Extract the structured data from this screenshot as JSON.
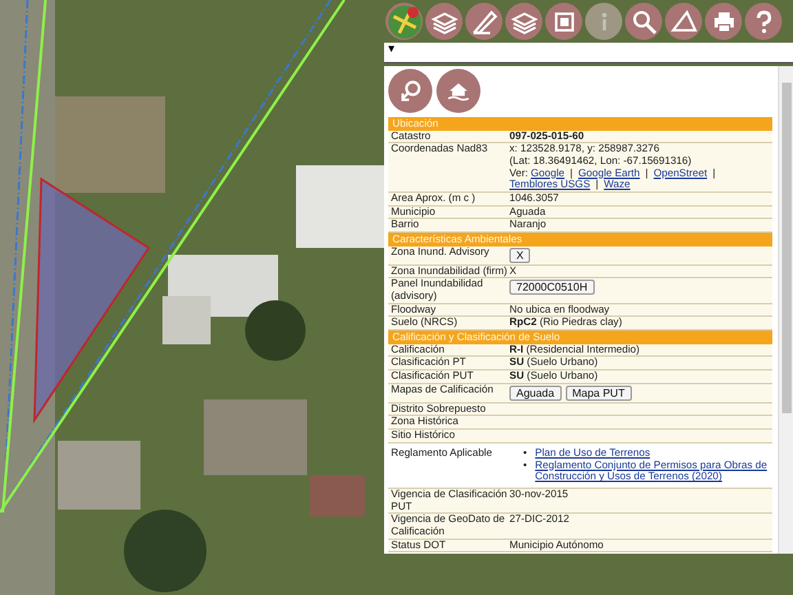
{
  "toolbar": [
    {
      "kind": "map",
      "disabled": false
    },
    {
      "kind": "layers",
      "disabled": false
    },
    {
      "kind": "pencil",
      "disabled": false
    },
    {
      "kind": "layers",
      "disabled": false
    },
    {
      "kind": "frame",
      "disabled": false
    },
    {
      "kind": "info",
      "disabled": true
    },
    {
      "kind": "search",
      "disabled": false
    },
    {
      "kind": "measure",
      "disabled": false
    },
    {
      "kind": "print",
      "disabled": false
    },
    {
      "kind": "help",
      "disabled": false
    }
  ],
  "panel_toggle": "▾",
  "panel_tools": [
    {
      "kind": "link"
    },
    {
      "kind": "flood"
    }
  ],
  "sections": [
    {
      "title": "Ubicación",
      "rows": [
        {
          "label": "Catastro",
          "kind": "text",
          "value": "**097-025-015-60**"
        },
        {
          "label": "Coordenadas Nad83",
          "kind": "coords",
          "lines": [
            "x: 123528.9178, y: 258987.3276",
            "(Lat: 18.36491462, Lon: -67.15691316)"
          ],
          "links_prefix": "Ver:",
          "separator": "|",
          "links": [
            "Google",
            "Google Earth",
            "OpenStreet",
            "Temblores USGS",
            "Waze"
          ]
        },
        {
          "label": "Area Aprox. (m c )",
          "kind": "text",
          "value": "1046.3057"
        },
        {
          "label": "Municipio",
          "kind": "text",
          "value": "Aguada"
        },
        {
          "label": "Barrio",
          "kind": "text",
          "value": "Naranjo"
        }
      ]
    },
    {
      "title": "Características Ambientales",
      "rows": [
        {
          "label": "Zona Inund. Advisory",
          "kind": "buttons",
          "buttons": [
            "X"
          ]
        },
        {
          "label": "Zona Inundabilidad (firm)",
          "kind": "text",
          "value": "X"
        },
        {
          "label": "Panel Inundabilidad (advisory)",
          "kind": "buttons",
          "buttons": [
            "72000C0510H"
          ]
        },
        {
          "label": "Floodway",
          "kind": "text",
          "value": "No ubica en floodway"
        },
        {
          "label": "Suelo (NRCS)",
          "kind": "text",
          "value": "**RpC2** (Rio Piedras clay)"
        }
      ]
    },
    {
      "title": "Calificación y Clasificación de Suelo",
      "rows": [
        {
          "label": "Calificación",
          "kind": "text",
          "value": "**R-I** (Residencial Intermedio)"
        },
        {
          "label": "Clasificación PT",
          "kind": "text",
          "value": "**SU** (Suelo Urbano)"
        },
        {
          "label": "Clasificación PUT",
          "kind": "text",
          "value": "**SU** (Suelo Urbano)"
        },
        {
          "label": "Mapas de Calificación",
          "kind": "buttons",
          "buttons": [
            "Aguada",
            "Mapa PUT"
          ]
        },
        {
          "label": "Distrito Sobrepuesto",
          "kind": "text"
        },
        {
          "label": "Zona Histórica",
          "kind": "text"
        },
        {
          "label": "Sitio Histórico",
          "kind": "text"
        },
        {
          "label": "Reglamento Aplicable",
          "kind": "linklist",
          "bullet": "•",
          "links": [
            "Plan de Uso de Terrenos",
            "Reglamento Conjunto de Permisos para Obras de Construcción y Usos de Terrenos (2020)"
          ]
        },
        {
          "label": "Vigencia de Clasificación PUT",
          "kind": "text",
          "value": "30-nov-2015"
        },
        {
          "label": "Vigencia de GeoDato de Calificación",
          "kind": "text",
          "value": "27-DIC-2012"
        },
        {
          "label": "Status DOT",
          "kind": "text",
          "value": "Municipio Autónomo"
        }
      ]
    }
  ]
}
